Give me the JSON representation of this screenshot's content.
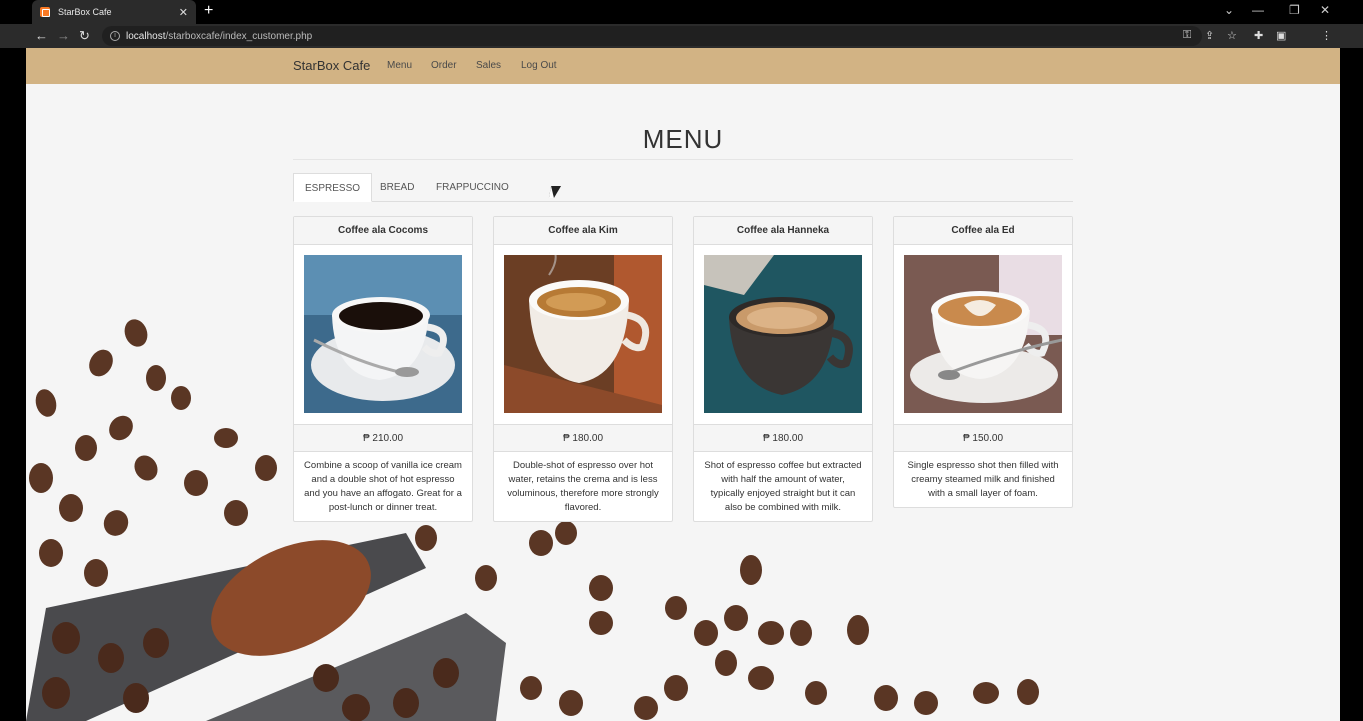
{
  "browser": {
    "tab_title": "StarBox Cafe",
    "url_host": "localhost",
    "url_path": "/starboxcafe/index_customer.php"
  },
  "navbar": {
    "brand": "StarBox Cafe",
    "links": [
      "Menu",
      "Order",
      "Sales",
      "Log Out"
    ]
  },
  "page": {
    "title": "MENU",
    "tabs": [
      "ESPRESSO",
      "BREAD",
      "FRAPPUCCINO"
    ],
    "active_tab": "ESPRESSO"
  },
  "products": [
    {
      "name": "Coffee ala Cocoms",
      "price": "₱ 210.00",
      "description": "Combine a scoop of vanilla ice cream and a double shot of hot espresso and you have an affogato. Great for a post-lunch or dinner treat."
    },
    {
      "name": "Coffee ala Kim",
      "price": "₱ 180.00",
      "description": "Double-shot of espresso over hot water, retains the crema and is less voluminous, therefore more strongly flavored."
    },
    {
      "name": "Coffee ala Hanneka",
      "price": "₱ 180.00",
      "description": "Shot of espresso coffee but extracted with half the amount of water, typically enjoyed straight but it can also be combined with milk."
    },
    {
      "name": "Coffee ala Ed",
      "price": "₱ 150.00",
      "description": "Single espresso shot then filled with creamy steamed milk and finished with a small layer of foam."
    }
  ],
  "colors": {
    "navbar": "#d2b384",
    "page_bg": "#f5f5f5"
  }
}
